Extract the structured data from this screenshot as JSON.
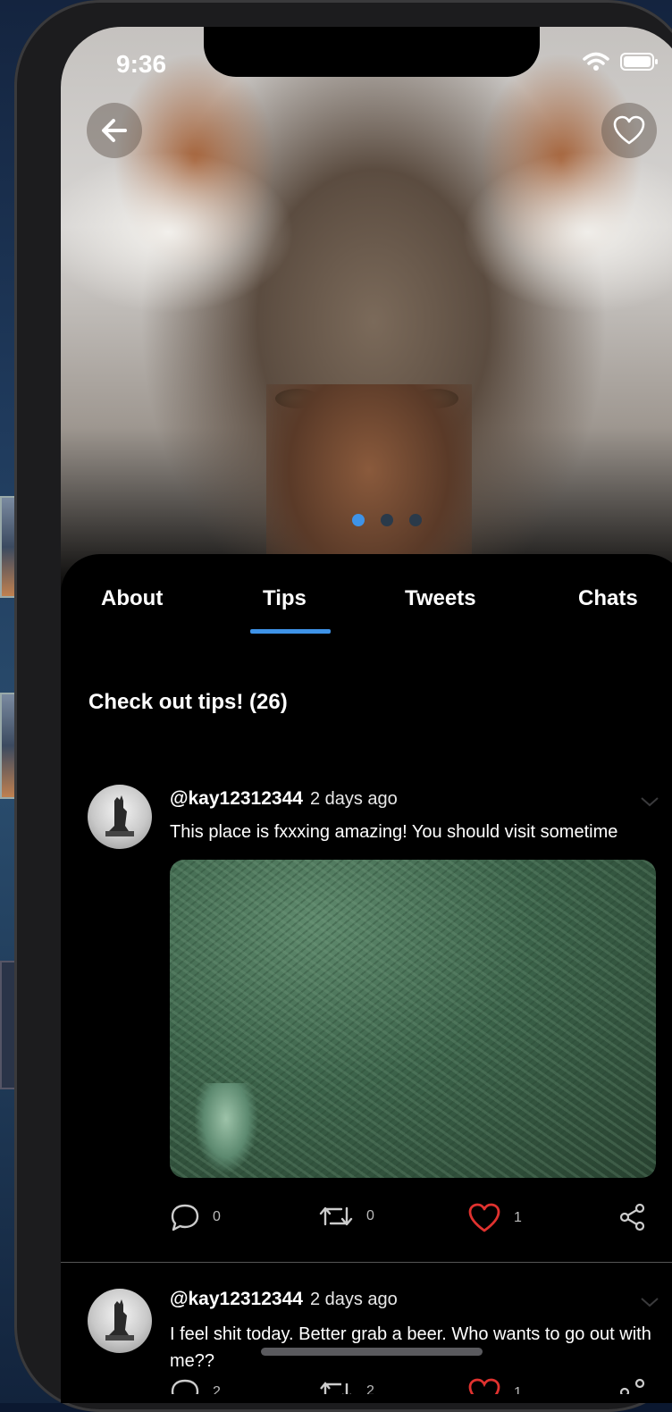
{
  "status_bar": {
    "time": "9:36"
  },
  "hero": {
    "carousel_count": 3,
    "carousel_active_index": 0
  },
  "tabs": [
    {
      "label": "About"
    },
    {
      "label": "Tips",
      "active": true
    },
    {
      "label": "Tweets"
    },
    {
      "label": "Chats"
    }
  ],
  "section": {
    "title": "Check out tips! (26)"
  },
  "posts": [
    {
      "handle": "@kay12312344",
      "time_ago": "2 days ago",
      "text": "This place is fxxxing amazing! You should visit sometime",
      "has_media": true,
      "comments": "0",
      "retweets": "0",
      "likes": "1",
      "liked": true
    },
    {
      "handle": "@kay12312344",
      "time_ago": "2 days ago",
      "text": "I feel shit today. Better grab a beer. Who wants to go out with me??",
      "has_media": false,
      "comments": "2",
      "retweets": "2",
      "likes": "1",
      "liked": true
    }
  ],
  "colors": {
    "accent": "#3e93e8",
    "like": "#e0322f",
    "background": "#000000"
  },
  "icons": [
    "back-arrow-icon",
    "heart-icon",
    "chevron-down-icon",
    "comment-icon",
    "retweet-icon",
    "share-icon",
    "wifi-icon",
    "battery-icon"
  ]
}
